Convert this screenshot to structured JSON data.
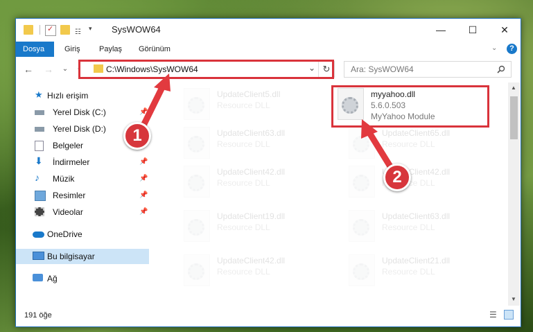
{
  "window": {
    "title": "SysWOW64",
    "minimize": "—",
    "maximize": "☐",
    "close": "✕"
  },
  "ribbon": {
    "tabs": [
      "Dosya",
      "Giriş",
      "Paylaş",
      "Görünüm"
    ],
    "help": "?"
  },
  "address": {
    "path": "C:\\Windows\\SysWOW64",
    "dropdown": "⌄",
    "refresh": "↻"
  },
  "search": {
    "placeholder": "Ara: SysWOW64",
    "icon": "search-icon"
  },
  "nav": {
    "back": "←",
    "forward": "→",
    "recent": "⌄",
    "up": "↑"
  },
  "sidebar": {
    "items": [
      {
        "label": "Hızlı erişim",
        "icon": "star-icon",
        "pinned": false
      },
      {
        "label": "Yerel Disk (C:)",
        "icon": "drive-icon",
        "pinned": true
      },
      {
        "label": "Yerel Disk (D:)",
        "icon": "drive-icon",
        "pinned": true
      },
      {
        "label": "Belgeler",
        "icon": "documents-icon",
        "pinned": true
      },
      {
        "label": "İndirmeler",
        "icon": "downloads-icon",
        "pinned": true
      },
      {
        "label": "Müzik",
        "icon": "music-icon",
        "pinned": true
      },
      {
        "label": "Resimler",
        "icon": "pictures-icon",
        "pinned": true
      },
      {
        "label": "Videolar",
        "icon": "videos-icon",
        "pinned": true
      },
      {
        "label": "OneDrive",
        "icon": "cloud-icon",
        "pinned": false
      },
      {
        "label": "Bu bilgisayar",
        "icon": "computer-icon",
        "pinned": false
      },
      {
        "label": "Ağ",
        "icon": "network-icon",
        "pinned": false
      }
    ]
  },
  "files": {
    "highlighted": {
      "name": "myyahoo.dll",
      "version": "5.6.0.503",
      "description": "MyYahoo Module"
    },
    "faded": [
      {
        "name": "UpdateClient5.dll",
        "desc": "Resource DLL"
      },
      {
        "name": "UpdateClient63.dll",
        "desc": "Resource DLL"
      },
      {
        "name": "UpdateClient65.dll",
        "desc": "Resource DLL"
      },
      {
        "name": "UpdateClient42.dll",
        "desc": "Resource DLL"
      },
      {
        "name": "UpdateClient42.dll",
        "desc": "Resource DLL"
      },
      {
        "name": "UpdateClient19.dll",
        "desc": "Resource DLL"
      },
      {
        "name": "UpdateClient63.dll",
        "desc": "Resource DLL"
      },
      {
        "name": "UpdateClient42.dll",
        "desc": "Resource DLL"
      },
      {
        "name": "UpdateClient21.dll",
        "desc": "Resource DLL"
      }
    ]
  },
  "status": {
    "count": "191 öğe"
  },
  "annotations": {
    "badge1": "1",
    "badge2": "2",
    "color": "#d9333b"
  }
}
